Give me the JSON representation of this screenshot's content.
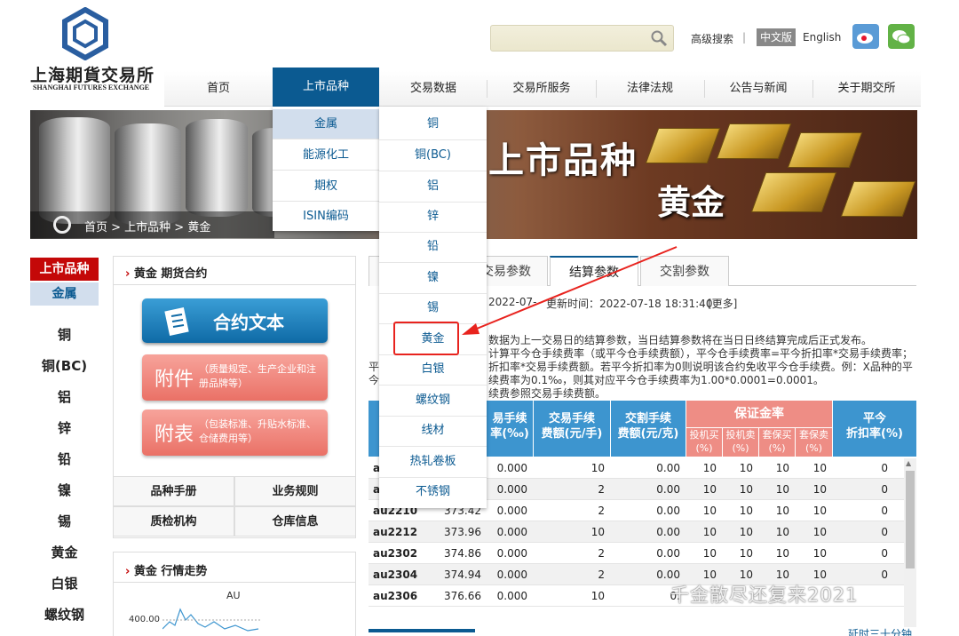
{
  "header": {
    "logo_cn": "上海期貨交易所",
    "logo_en": "SHANGHAI FUTURES EXCHANGE",
    "advanced_search": "高级搜索",
    "separator": "|",
    "lang_cn": "中文版",
    "lang_en": "English"
  },
  "nav": [
    "首页",
    "上市品种",
    "交易数据",
    "交易所服务",
    "法律法规",
    "公告与新闻",
    "关于期交所"
  ],
  "banner": {
    "breadcrumb": "首页 > 上市品种 > 黄金",
    "title": "上市品种",
    "subtitle": "黄金"
  },
  "dropdown_categories": [
    "金属",
    "能源化工",
    "期权",
    "ISIN编码"
  ],
  "dropdown_products": [
    "铜",
    "铜(BC)",
    "铝",
    "锌",
    "铅",
    "镍",
    "锡",
    "黄金",
    "白银",
    "螺纹钢",
    "线材",
    "热轧卷板",
    "不锈钢"
  ],
  "sidebar": {
    "header": "上市品种",
    "sub": "金属",
    "items": [
      "铜",
      "铜(BC)",
      "铝",
      "锌",
      "铅",
      "镍",
      "锡",
      "黄金",
      "白银",
      "螺纹钢"
    ]
  },
  "contract_box": {
    "title": "黄金 期货合约",
    "contract_text": "合约文本",
    "annex_label": "附件",
    "annex_desc": "（质量规定、生产企业和注册品牌等）",
    "schedule_label": "附表",
    "schedule_desc": "（包装标准、升贴水标准、仓储费用等）",
    "links": [
      "品种手册",
      "业务规则",
      "质检机构",
      "仓库信息"
    ]
  },
  "trend_box": {
    "title": "黄金 行情走势",
    "chart_label": "AU",
    "y_tick": "400.00"
  },
  "tabs": [
    "交易参数",
    "结算参数",
    "交割参数"
  ],
  "settlement": {
    "date_prefix": "2022-07-",
    "update_text": "更新时间：2022-07-18 18:31:40",
    "more": "[更多]",
    "notes": [
      "数据为上一交易日的结算参数，当日结算参数将在当日日终结算完成后正式发布。",
      "计算平今仓手续费率（或平今仓手续费额），平今仓手续费率=平今折扣率*交易手续费率；",
      "折扣率*交易手续费额。若平今折扣率为0则说明该合约免收平今仓手续费。例：X品种的平",
      "续费率为0.1‰，则其对应平今仓手续费率为1.00*0.0001=0.0001。",
      "续费参照交易手续费额。"
    ],
    "left_edge_notes": [
      "平",
      "今"
    ]
  },
  "table": {
    "headers": {
      "rate": "易手续\n率(‰)",
      "fee": "交易手续\n费额(元/手)",
      "delivery_fee": "交割手续\n费额(元/克)",
      "margin": "保证金率",
      "margin_sub": [
        "投机买\n(%)",
        "投机卖\n(%)",
        "套保买\n(%)",
        "套保卖\n(%)"
      ],
      "close_today": "平今\n折扣率(%)"
    },
    "rows": [
      {
        "contract": "a",
        "price": "",
        "rate": "0.000",
        "fee": "10",
        "delivery": "0.00",
        "m1": "10",
        "m2": "10",
        "m3": "10",
        "m4": "10",
        "disc": "0"
      },
      {
        "contract": "a",
        "price": "",
        "rate": "0.000",
        "fee": "2",
        "delivery": "0.00",
        "m1": "10",
        "m2": "10",
        "m3": "10",
        "m4": "10",
        "disc": "0"
      },
      {
        "contract": "au2210",
        "price": "373.42",
        "rate": "0.000",
        "fee": "2",
        "delivery": "0.00",
        "m1": "10",
        "m2": "10",
        "m3": "10",
        "m4": "10",
        "disc": "0"
      },
      {
        "contract": "au2212",
        "price": "373.96",
        "rate": "0.000",
        "fee": "10",
        "delivery": "0.00",
        "m1": "10",
        "m2": "10",
        "m3": "10",
        "m4": "10",
        "disc": "0"
      },
      {
        "contract": "au2302",
        "price": "374.86",
        "rate": "0.000",
        "fee": "2",
        "delivery": "0.00",
        "m1": "10",
        "m2": "10",
        "m3": "10",
        "m4": "10",
        "disc": "0"
      },
      {
        "contract": "au2304",
        "price": "374.94",
        "rate": "0.000",
        "fee": "2",
        "delivery": "0.00",
        "m1": "10",
        "m2": "10",
        "m3": "10",
        "m4": "10",
        "disc": "0"
      },
      {
        "contract": "au2306",
        "price": "376.66",
        "rate": "0.000",
        "fee": "10",
        "delivery": "0.",
        "m1": "",
        "m2": "",
        "m3": "",
        "m4": "",
        "disc": ""
      }
    ]
  },
  "footer_right": "延时三十分钟",
  "watermark": "千金散尽还复来2021",
  "colors": {
    "brand_blue": "#0b5a91",
    "header_red": "#c40808",
    "highlight": "#e8231e"
  }
}
